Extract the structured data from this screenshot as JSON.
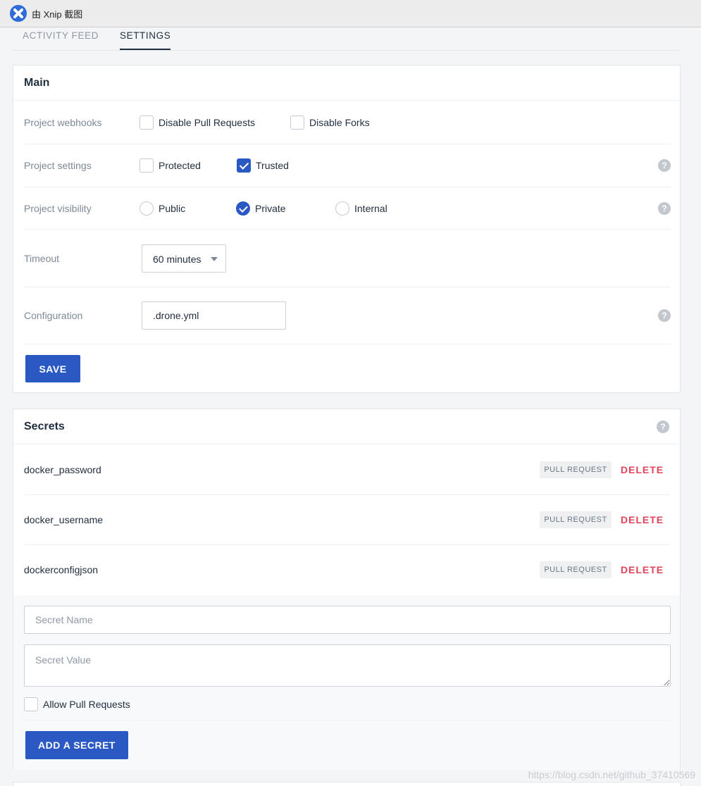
{
  "window": {
    "title": "由 Xnip 截图"
  },
  "tabs": [
    {
      "label": "ACTIVITY FEED",
      "active": false
    },
    {
      "label": "SETTINGS",
      "active": true
    }
  ],
  "main": {
    "title": "Main",
    "webhooks": {
      "label": "Project webhooks",
      "options": [
        {
          "label": "Disable Pull Requests",
          "checked": false
        },
        {
          "label": "Disable Forks",
          "checked": false
        }
      ]
    },
    "settings": {
      "label": "Project settings",
      "options": [
        {
          "label": "Protected",
          "checked": false
        },
        {
          "label": "Trusted",
          "checked": true
        }
      ],
      "help_icon": "?"
    },
    "visibility": {
      "label": "Project visibility",
      "options": [
        {
          "label": "Public",
          "selected": false
        },
        {
          "label": "Private",
          "selected": true
        },
        {
          "label": "Internal",
          "selected": false
        }
      ],
      "help_icon": "?"
    },
    "timeout": {
      "label": "Timeout",
      "value": "60 minutes"
    },
    "configuration": {
      "label": "Configuration",
      "value": ".drone.yml",
      "help_icon": "?"
    },
    "save_label": "SAVE"
  },
  "secrets": {
    "title": "Secrets",
    "help_icon": "?",
    "items": [
      {
        "name": "docker_password",
        "badge": "PULL REQUEST",
        "delete_label": "DELETE"
      },
      {
        "name": "docker_username",
        "badge": "PULL REQUEST",
        "delete_label": "DELETE"
      },
      {
        "name": "dockerconfigjson",
        "badge": "PULL REQUEST",
        "delete_label": "DELETE"
      }
    ],
    "form": {
      "name_placeholder": "Secret Name",
      "value_placeholder": "Secret Value",
      "allow_pr_label": "Allow Pull Requests",
      "allow_pr_checked": false,
      "add_label": "ADD A SECRET"
    }
  },
  "watermark": "https://blog.csdn.net/github_37410569",
  "colors": {
    "accent": "#2b59c3",
    "danger": "#e0435a"
  }
}
